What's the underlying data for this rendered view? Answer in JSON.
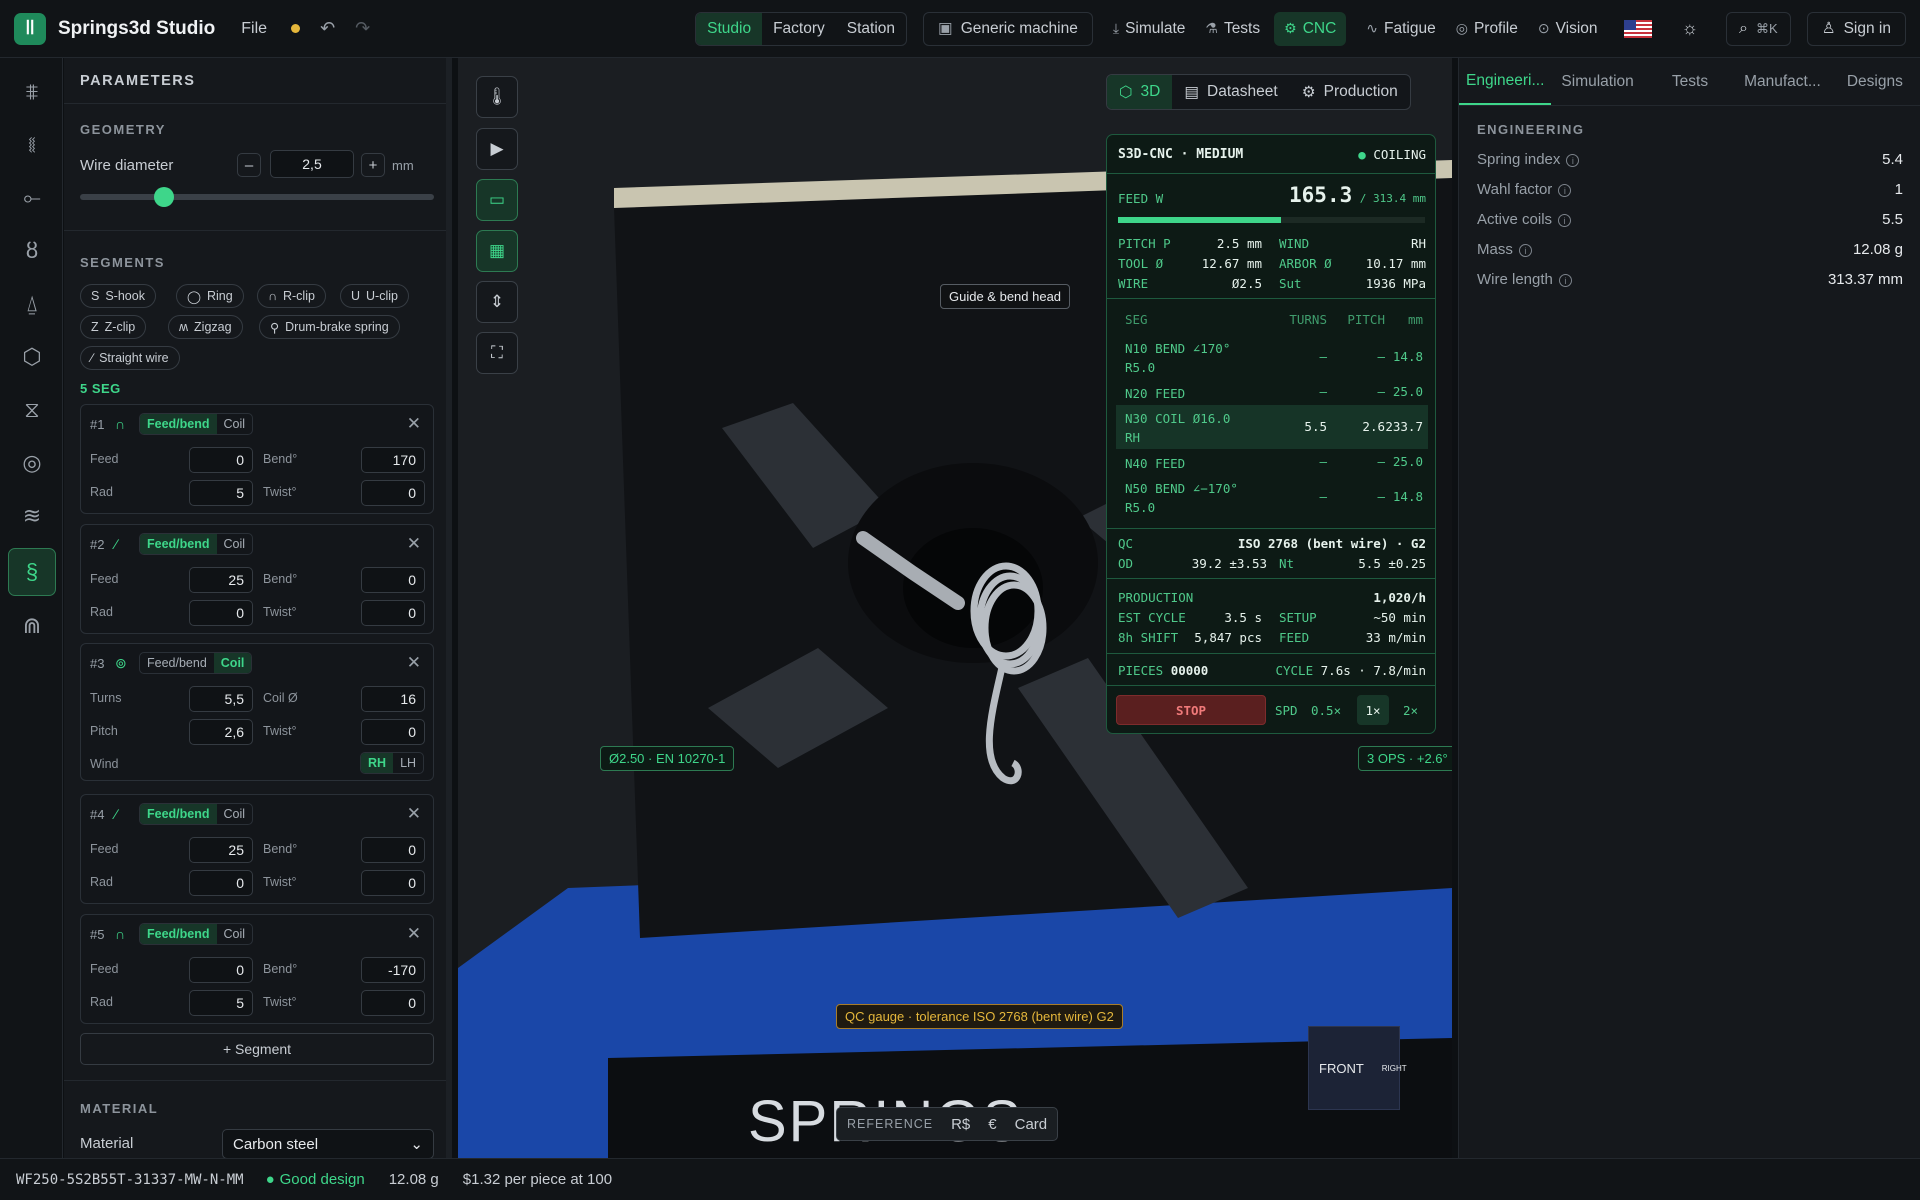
{
  "topbar": {
    "brand": "Springs3d Studio",
    "file_menu": "File",
    "modes": [
      "Studio",
      "Factory",
      "Station"
    ],
    "machine": "Generic machine",
    "nav": [
      "Simulate",
      "Tests",
      "CNC",
      "Fatigue",
      "Profile",
      "Vision"
    ],
    "search_shortcut": "⌘K",
    "sign_in": "Sign in"
  },
  "params": {
    "title": "PARAMETERS",
    "geometry_title": "GEOMETRY",
    "wire_diameter_label": "Wire diameter",
    "wire_diameter_value": "2,5",
    "wire_diameter_unit": "mm",
    "wire_diameter_slider_fraction": 0.21,
    "segments_title": "SEGMENTS",
    "presets": [
      "S-hook",
      "Ring",
      "R-clip",
      "U-clip",
      "Z-clip",
      "Zigzag",
      "Drum-brake spring",
      "Straight wire"
    ],
    "seg_count": "5 SEG",
    "feedbend_label": "Feed/bend",
    "coil_label": "Coil",
    "add_segment": "+ Segment",
    "material_title": "MATERIAL",
    "material_label": "Material",
    "material_value": "Carbon steel"
  },
  "segments": [
    {
      "num": "#1",
      "mode": "feedbend",
      "f1_label": "Feed",
      "f1": "0",
      "f2_label": "Bend°",
      "f2": "170",
      "f3_label": "Rad",
      "f3": "5",
      "f4_label": "Twist°",
      "f4": "0"
    },
    {
      "num": "#2",
      "mode": "feedbend",
      "f1_label": "Feed",
      "f1": "25",
      "f2_label": "Bend°",
      "f2": "0",
      "f3_label": "Rad",
      "f3": "0",
      "f4_label": "Twist°",
      "f4": "0"
    },
    {
      "num": "#3",
      "mode": "coil",
      "f1_label": "Turns",
      "f1": "5,5",
      "f2_label": "Coil Ø",
      "f2": "16",
      "f3_label": "Pitch",
      "f3": "2,6",
      "f4_label": "Twist°",
      "f4": "0",
      "wind_label": "Wind",
      "wind_rh": "RH",
      "wind_lh": "LH"
    },
    {
      "num": "#4",
      "mode": "feedbend",
      "f1_label": "Feed",
      "f1": "25",
      "f2_label": "Bend°",
      "f2": "0",
      "f3_label": "Rad",
      "f3": "0",
      "f4_label": "Twist°",
      "f4": "0"
    },
    {
      "num": "#5",
      "mode": "feedbend",
      "f1_label": "Feed",
      "f1": "0",
      "f2_label": "Bend°",
      "f2": "-170",
      "f3_label": "Rad",
      "f3": "5",
      "f4_label": "Twist°",
      "f4": "0"
    }
  ],
  "viewport": {
    "tabs": [
      "3D",
      "Datasheet",
      "Production"
    ],
    "tooltip": "Guide & bend head",
    "wire_tag": "Ø2.50 · EN 10270-1",
    "ops_tag": "3 OPS · +2.6°",
    "qc_tag": "QC gauge · tolerance ISO 2768 (bent wire) G2",
    "cube_front": "FRONT",
    "cube_right": "RIGHT",
    "reference_label": "REFERENCE",
    "currencies": [
      "R$",
      "€",
      "Card"
    ],
    "floor_text": "SPRINGS"
  },
  "cnc": {
    "title": "S3D-CNC · MEDIUM",
    "state": "COILING",
    "feed_label": "FEED W",
    "feed_value": "165.3",
    "feed_total": "/ 313.4 mm",
    "feed_progress_fraction": 0.53,
    "specs": [
      [
        "PITCH P",
        "2.5 mm",
        "WIND",
        "RH"
      ],
      [
        "TOOL Ø",
        "12.67 mm",
        "ARBOR Ø",
        "10.17 mm"
      ],
      [
        "WIRE",
        "Ø2.5",
        "Sut",
        "1936 MPa"
      ]
    ],
    "table_headers": [
      "SEG",
      "TURNS",
      "PITCH",
      "mm"
    ],
    "rows": [
      {
        "seg": "N10 BEND ∠170°",
        "seg2": "R5.0",
        "turns": "—",
        "pitch": "—",
        "mm": "14.8"
      },
      {
        "seg": "N20 FEED",
        "seg2": "",
        "turns": "—",
        "pitch": "—",
        "mm": "25.0"
      },
      {
        "seg": "N30 COIL Ø16.0",
        "seg2": "RH",
        "turns": "5.5",
        "pitch": "2.6",
        "mm": "233.7"
      },
      {
        "seg": "N40 FEED",
        "seg2": "",
        "turns": "—",
        "pitch": "—",
        "mm": "25.0"
      },
      {
        "seg": "N50 BEND ∠−170°",
        "seg2": "R5.0",
        "turns": "—",
        "pitch": "—",
        "mm": "14.8"
      }
    ],
    "qc_label": "QC",
    "qc_value": "ISO 2768 (bent wire) · G2",
    "od_label": "OD",
    "od_value": "39.2 ±3.53",
    "nt_label": "Nt",
    "nt_value": "5.5 ±0.25",
    "production_label": "PRODUCTION",
    "production_rate": "1,020/h",
    "est_cycle_label": "EST CYCLE",
    "est_cycle": "3.5 s",
    "setup_label": "SETUP",
    "setup": "~50 min",
    "shift_label": "8h SHIFT",
    "shift": "5,847 pcs",
    "feed_rate_label": "FEED",
    "feed_rate": "33 m/min",
    "pieces_label": "PIECES",
    "pieces": "00000",
    "cycle_label": "CYCLE",
    "cycle": "7.6s · 7.8/min",
    "stop": "STOP",
    "spd_label": "SPD",
    "speeds": [
      "0.5×",
      "1×",
      "2×"
    ]
  },
  "right": {
    "tabs": [
      "Engineeri...",
      "Simulation",
      "Tests",
      "Manufact...",
      "Designs"
    ],
    "section": "ENGINEERING",
    "items": [
      {
        "k": "Spring index",
        "v": "5.4"
      },
      {
        "k": "Wahl factor",
        "v": "1"
      },
      {
        "k": "Active coils",
        "v": "5.5"
      },
      {
        "k": "Mass",
        "v": "12.08 g"
      },
      {
        "k": "Wire length",
        "v": "313.37 mm"
      }
    ]
  },
  "status": {
    "code": "WF250-5S2B55T-31337-MW-N-MM",
    "quality": "Good design",
    "mass": "12.08 g",
    "price": "$1.32 per piece at 100"
  },
  "colors": {
    "accent": "#3ed68a",
    "warning": "#e5b73b",
    "stop": "#5a1f1f",
    "machine_blue": "#1a47a8"
  }
}
